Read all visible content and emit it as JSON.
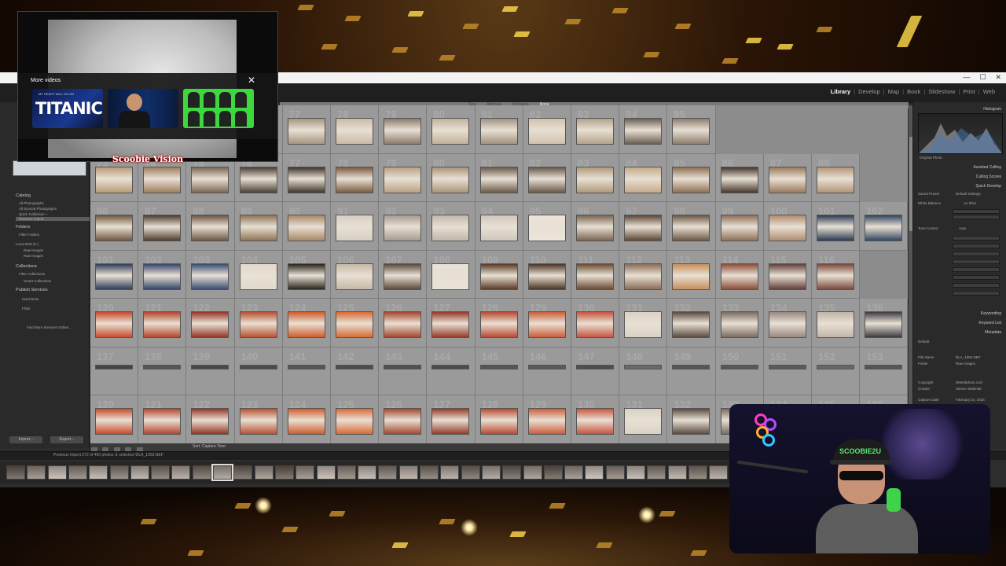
{
  "lightroom": {
    "modules": [
      "Library",
      "Develop",
      "Map",
      "Book",
      "Slideshow",
      "Print",
      "Web"
    ],
    "active_module": "Library",
    "left_panel": {
      "catalog_header": "Catalog",
      "catalog_items": [
        "All Photographs",
        "All Synced Photographs",
        "Quick Collection +",
        "Previous Import"
      ],
      "folders_header": "Folders",
      "folder_items": [
        "Filter Folders",
        "Local Disk (F:)",
        "Raw Images",
        "Raw Images"
      ],
      "collections_header": "Collections",
      "collection_items": [
        "Filter Collections",
        "Smart Collections"
      ],
      "publish_header": "Publish Services",
      "publish_items": [
        "Hard Drive",
        "Flickr"
      ],
      "find_more": "Find More Services Online...",
      "import_button": "Import...",
      "export_button": "Export..."
    },
    "filter_bar": [
      "Text",
      "Attribute",
      "Metadata",
      "None"
    ],
    "right_panel": {
      "histogram_header": "Histogram",
      "original_photo": "Original Photo",
      "assisted_culling": "Assisted Culling",
      "culling_scores": "Culling Scores",
      "quick_develop": "Quick Develop",
      "saved_preset": "Saved Preset",
      "saved_preset_value": "Default Settings",
      "white_balance": "White Balance",
      "white_balance_value": "As Shot",
      "tone_control": "Tone Control",
      "tone_control_value": "Auto",
      "keywording": "Keywording",
      "keyword_list": "Keyword List",
      "metadata": "Metadata",
      "metadata_preset": "Default",
      "file_name_label": "File Name",
      "file_name": "DLA_1053.NEF",
      "folder_label": "Folder",
      "folder": "Raw Images",
      "copyright_label": "Copyright",
      "copyright": "DMeritphoto.com",
      "creator_label": "Creator",
      "creator": "Steven Walende",
      "capture_label": "Capture Date",
      "capture_date": "February 24, 2024"
    },
    "grid_rows": [
      {
        "start": 73,
        "type": "room",
        "tones": [
          "#6b5d4f",
          "#c7b9a3",
          "#9c8a74",
          "#b8a993",
          "#a6957f",
          "#c9bba5",
          "#8b7c6c",
          "#c2b19a",
          "#a29280",
          "#d1c2ad",
          "#b3a28b",
          "#6a5e52",
          "#8d7e6e"
        ]
      },
      {
        "start": 73,
        "type": "room",
        "tones": [
          "#b89a78",
          "#9e7e5d",
          "#7a6553",
          "#4a3f36",
          "#3e342c",
          "#7b5a40",
          "#b9a184",
          "#a99479",
          "#6a5a49",
          "#665848",
          "#b1997b",
          "#c4aa88",
          "#8d6f52",
          "#46372c",
          "#9a7a5b",
          "#b29578"
        ]
      },
      {
        "start": 86,
        "type": "room",
        "tones": [
          "#6f5740",
          "#4e3c2c",
          "#6c5544",
          "#8f7354",
          "#a78866",
          "#d7cfc4",
          "#a59b90",
          "#c0b6aa",
          "#d0c7bc",
          "#ece4da",
          "#7b6350",
          "#5c4636",
          "#6c5644",
          "#8f6f57",
          "#b08b6f",
          "#2b3a52",
          "#324660"
        ]
      },
      {
        "start": 101,
        "type": "room",
        "tones": [
          "#2f3d58",
          "#34456a",
          "#3a4c72",
          "#e2d9cc",
          "#2b241d",
          "#c6b8a5",
          "#5b4a3a",
          "#e8e1d8",
          "#5a3b25",
          "#4b3525",
          "#6a4b33",
          "#8a6d58",
          "#c78e5b",
          "#8c4e3a",
          "#60403a",
          "#7a4a3c"
        ]
      },
      {
        "start": 120,
        "type": "orange",
        "tones": [
          "#c94a2a",
          "#b5452c",
          "#943626",
          "#b85230",
          "#cf5c2c",
          "#d86a36",
          "#a5472e",
          "#963a28",
          "#b84a30",
          "#cc5d3a",
          "#c8543e",
          "#d9d2c4",
          "#5a4a40",
          "#7a6a60",
          "#9a8880",
          "#c1b5a6",
          "#3d3a40"
        ]
      },
      {
        "start": 137,
        "type": "thin",
        "tones": [
          "#444",
          "#555",
          "#484848",
          "#4a4a4a",
          "#555",
          "#4c4c4c",
          "#505050",
          "#4a4a4a",
          "#555",
          "#5a5a5a",
          "#4e4e4e",
          "#6a6a6a",
          "#555",
          "#585858",
          "#5a5a5a",
          "#666",
          "#555"
        ]
      },
      {
        "start": 120,
        "type": "orange",
        "tones": [
          "#c94a2a",
          "#b5452c",
          "#943626",
          "#b85230",
          "#cf5c2c",
          "#d86a36",
          "#a5472e",
          "#963a28",
          "#b84a30",
          "#cc5d3a",
          "#c8543e",
          "#d9d2c4",
          "#5a4a40",
          "#7a6a60",
          "#9a8880",
          "#c1b5a6",
          "#3d3a40"
        ]
      }
    ],
    "toolbar_sort": "Sort: Capture Time",
    "status_text": "Previous Import   272 of 400 photos /1 selected /DLA_1053.NEF",
    "film_count": 35,
    "film_selected": 10
  },
  "youtube_overlay": {
    "header": "More videos",
    "close_glyph": "✕",
    "rec1_small": "MY HEART WILL GO ON",
    "rec1_title": "TITANIC",
    "brand": "Scoobie Vision"
  },
  "webcam": {
    "hat_text": "SCOOBIE2U"
  }
}
